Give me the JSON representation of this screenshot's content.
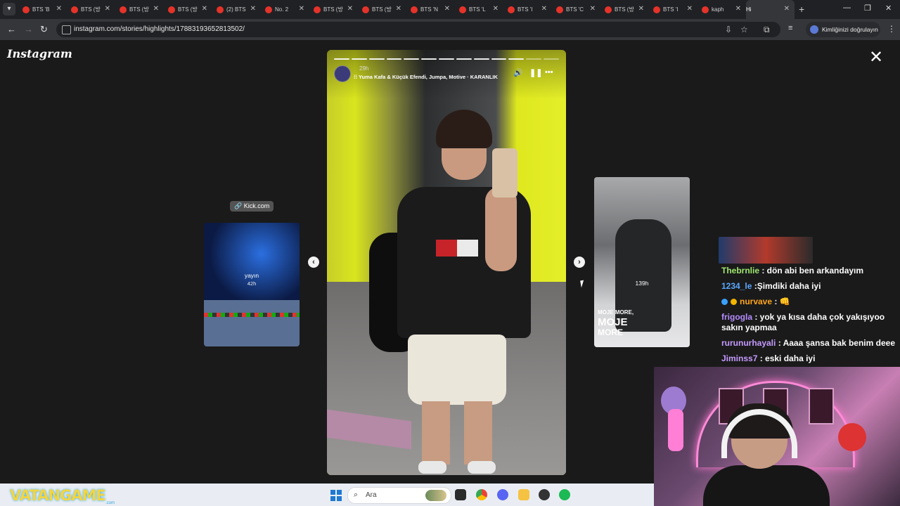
{
  "browser": {
    "tabs": [
      {
        "title": "BTS 'B",
        "icon": "youtube-icon"
      },
      {
        "title": "BTS (방",
        "icon": "youtube-icon"
      },
      {
        "title": "BTS (방",
        "icon": "youtube-icon"
      },
      {
        "title": "BTS (방",
        "icon": "youtube-icon"
      },
      {
        "title": "(2) BTS",
        "icon": "youtube-icon"
      },
      {
        "title": "No. 2",
        "icon": "youtube-icon"
      },
      {
        "title": "BTS (방",
        "icon": "youtube-icon"
      },
      {
        "title": "BTS (방",
        "icon": "youtube-icon"
      },
      {
        "title": "BTS 'N",
        "icon": "youtube-icon"
      },
      {
        "title": "BTS 'L",
        "icon": "youtube-icon"
      },
      {
        "title": "BTS 'I",
        "icon": "youtube-icon"
      },
      {
        "title": "BTS 'C",
        "icon": "youtube-icon"
      },
      {
        "title": "BTS (방",
        "icon": "youtube-icon"
      },
      {
        "title": "BTS 'I",
        "icon": "youtube-icon"
      },
      {
        "title": "kaph",
        "icon": "youtube-icon"
      },
      {
        "title": "Hi",
        "icon": "instagram-icon",
        "active": true
      }
    ],
    "url": "instagram.com/stories/highlights/17883193652813502/",
    "profile_label": "Kimliğinizi doğrulayın"
  },
  "instagram": {
    "logo": "Instagram",
    "story": {
      "segments_total": 13,
      "segments_viewed": 11,
      "time": "29h",
      "music": "Yuma Kafa & Küçük Efendi, Jumpa, Motive · KARANLIK"
    },
    "prev_preview": {
      "link_label": "Kick.com",
      "name": "yayın",
      "time": "42h"
    },
    "next_preview": {
      "time": "139h",
      "caption_small": "MOJE MORE,",
      "caption_big1": "MOJE",
      "caption_big2": "MORE"
    }
  },
  "chat": [
    {
      "user": "Thebrnlie",
      "color": "#9fe870",
      "text": " : dön abi ben arkandayım"
    },
    {
      "user": "1234_le",
      "color": "#5aa8ff",
      "text": " :Şimdiki daha iyi"
    },
    {
      "user": "nurvave",
      "color": "#ffa51f",
      "text": " : 👊",
      "badges": true
    },
    {
      "user": "frigogla",
      "color": "#b68cff",
      "text": " : yok ya kısa daha çok yakışıyoo sakın yapmaa"
    },
    {
      "user": "rurunurhayali",
      "color": "#c59bff",
      "text": " : Aaaa şansa bak benim deee"
    },
    {
      "user": "Jiminss7",
      "color": "#c59bff",
      "text": " : eski daha iyi"
    }
  ],
  "taskbar": {
    "search_placeholder": "Ara",
    "watermark": "VATANGAME",
    "watermark_sub": ".com"
  }
}
